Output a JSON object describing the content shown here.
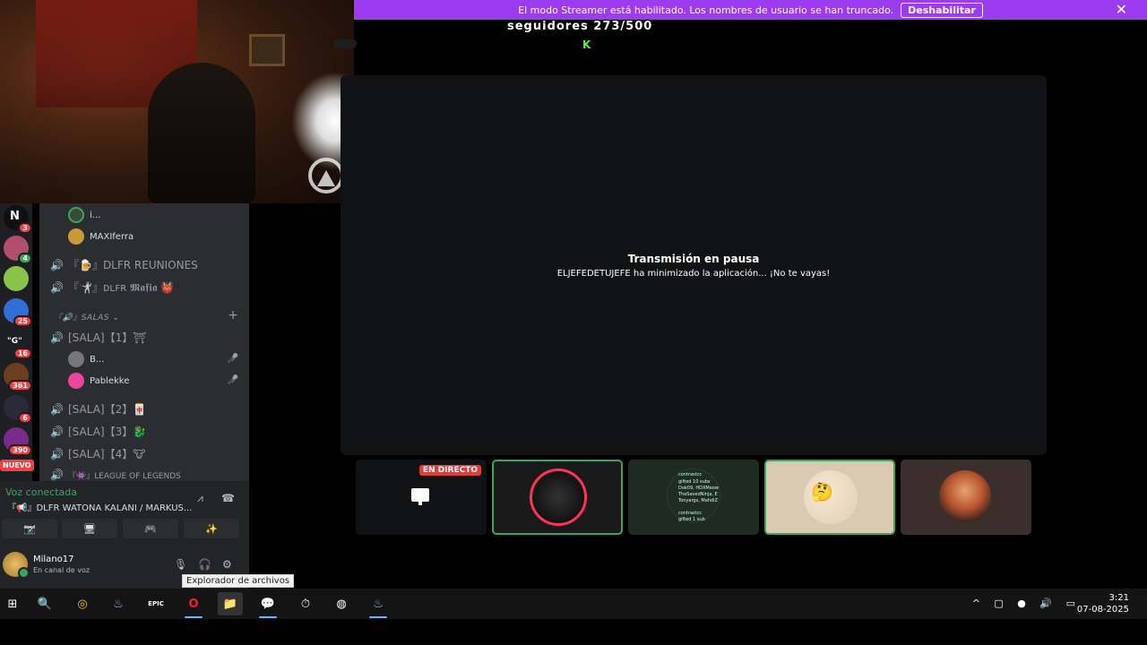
{
  "streamer_banner": {
    "message": "El modo Streamer está habilitado. Los nombres de usuario se han truncado.",
    "disable_label": "Deshabilitar",
    "close_icon": "✕"
  },
  "overlay": {
    "followers": "seguidores 273/500",
    "kick_logo": "K"
  },
  "stream": {
    "paused_title": "Transmisión en pausa",
    "paused_message": "ELJEFEDETUJEFE ha minimizado la aplicación... ¡No te vayas!"
  },
  "thumbnails": {
    "live_badge": "EN DIRECTO",
    "text_lines": [
      "contrastcc",
      "gifted 10 subs",
      "Dok09, HDXMeow",
      "TheSavedNinja, E",
      "Tonyargs, MahdiZ",
      "contrastcc",
      "gifted 1 sub"
    ]
  },
  "server_rail": {
    "servers": [
      {
        "icon": "N",
        "badge": "3",
        "color": "#101010"
      },
      {
        "icon": "",
        "badge": "4",
        "color": "#b14e6c"
      },
      {
        "icon": "",
        "badge": "",
        "color": "#8bc34a"
      },
      {
        "icon": "",
        "badge": "25",
        "color": "#2f6fd6"
      },
      {
        "icon": "\"G\"",
        "badge": "16",
        "color": "#1e1f22"
      },
      {
        "icon": "",
        "badge": "361",
        "color": "#6b3f1d"
      },
      {
        "icon": "",
        "badge": "6",
        "color": "#2a2a3a"
      },
      {
        "icon": "",
        "badge": "390",
        "color": "#7a2a8a"
      }
    ],
    "nuevo_label": "NUEVO"
  },
  "channels": {
    "top_users": [
      {
        "name": "i...",
        "color": "#3a4a3a"
      },
      {
        "name": "MAXIferra",
        "color": "#c89a3a"
      }
    ],
    "voice_channels_top": [
      {
        "name": "『🍺』DLFR REUNIONES"
      },
      {
        "name": "『🤺』ᴅʟꜰʀ 𝕸𝖆𝖋𝖎𝖆 👹"
      }
    ],
    "category": "『🔊』SALAS ⌄",
    "add_icon": "+",
    "salas": [
      {
        "name": "[SALA]【1】⛩"
      },
      {
        "name": "[SALA]【2】🀄"
      },
      {
        "name": "[SALA]【3】🐉"
      },
      {
        "name": "[SALA]【4】🐮"
      },
      {
        "name": "『👾』LEAGUE OF LEGENDS"
      }
    ],
    "sala1_users": [
      {
        "name": "B...",
        "color": "#777"
      },
      {
        "name": "Pablekke",
        "color": "#eb459e"
      }
    ]
  },
  "voice_panel": {
    "status": "Voz conectada",
    "channel": "『📢』DLFR WATONA KALANI / MARKUS...",
    "buttons": [
      "📷̸",
      "🖥",
      "🎮",
      "✨"
    ],
    "username": "Milano17",
    "user_status": "En canal de voz"
  },
  "tooltip": {
    "text": "Explorador de archivos"
  },
  "taskbar": {
    "apps": [
      "⊞",
      "🔍",
      "◎",
      "♨",
      "EPIC",
      "O",
      "📁",
      "💬",
      "⏱",
      "◍",
      "♨"
    ],
    "tray": "^ ▢ ● 🔊 ▭",
    "time": "3:21",
    "date": "07-08-2025"
  }
}
